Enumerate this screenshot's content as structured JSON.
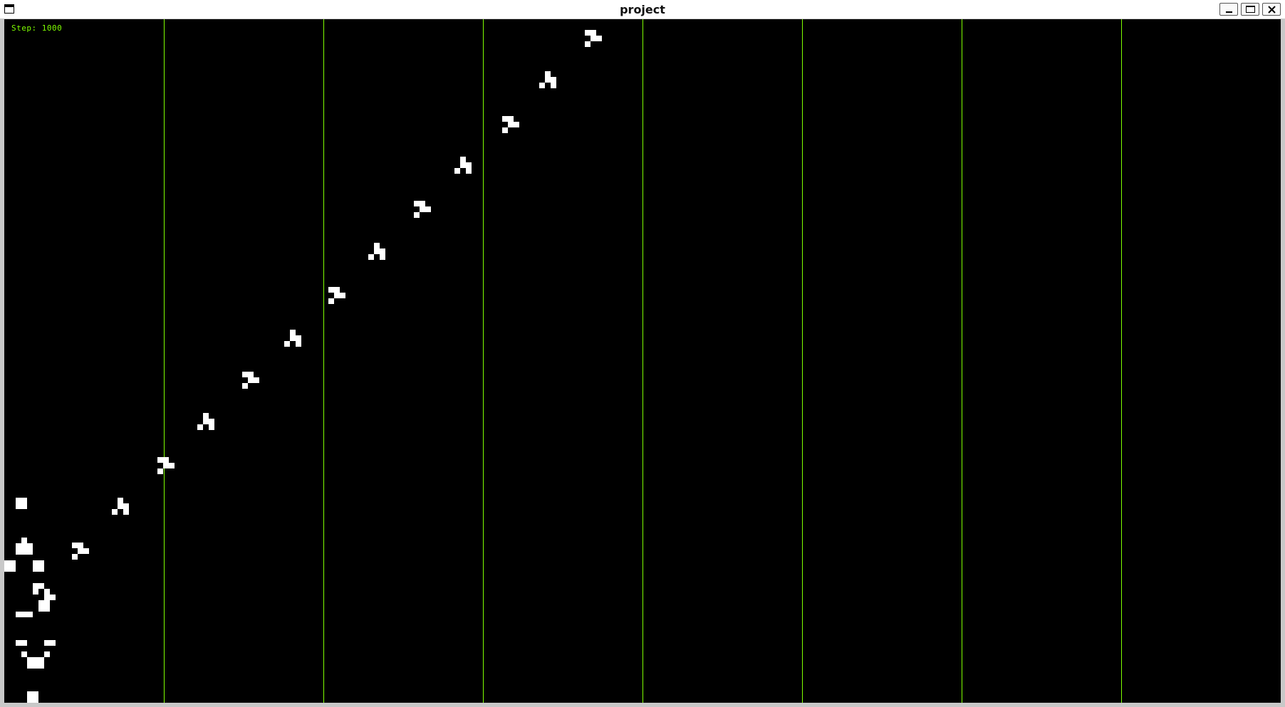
{
  "window": {
    "title": "project"
  },
  "simulation": {
    "step_label": "Step: 1000",
    "cell_color": "#ffffff",
    "divider_color": "#7fff00",
    "background_color": "#000000",
    "divider_count": 7
  }
}
